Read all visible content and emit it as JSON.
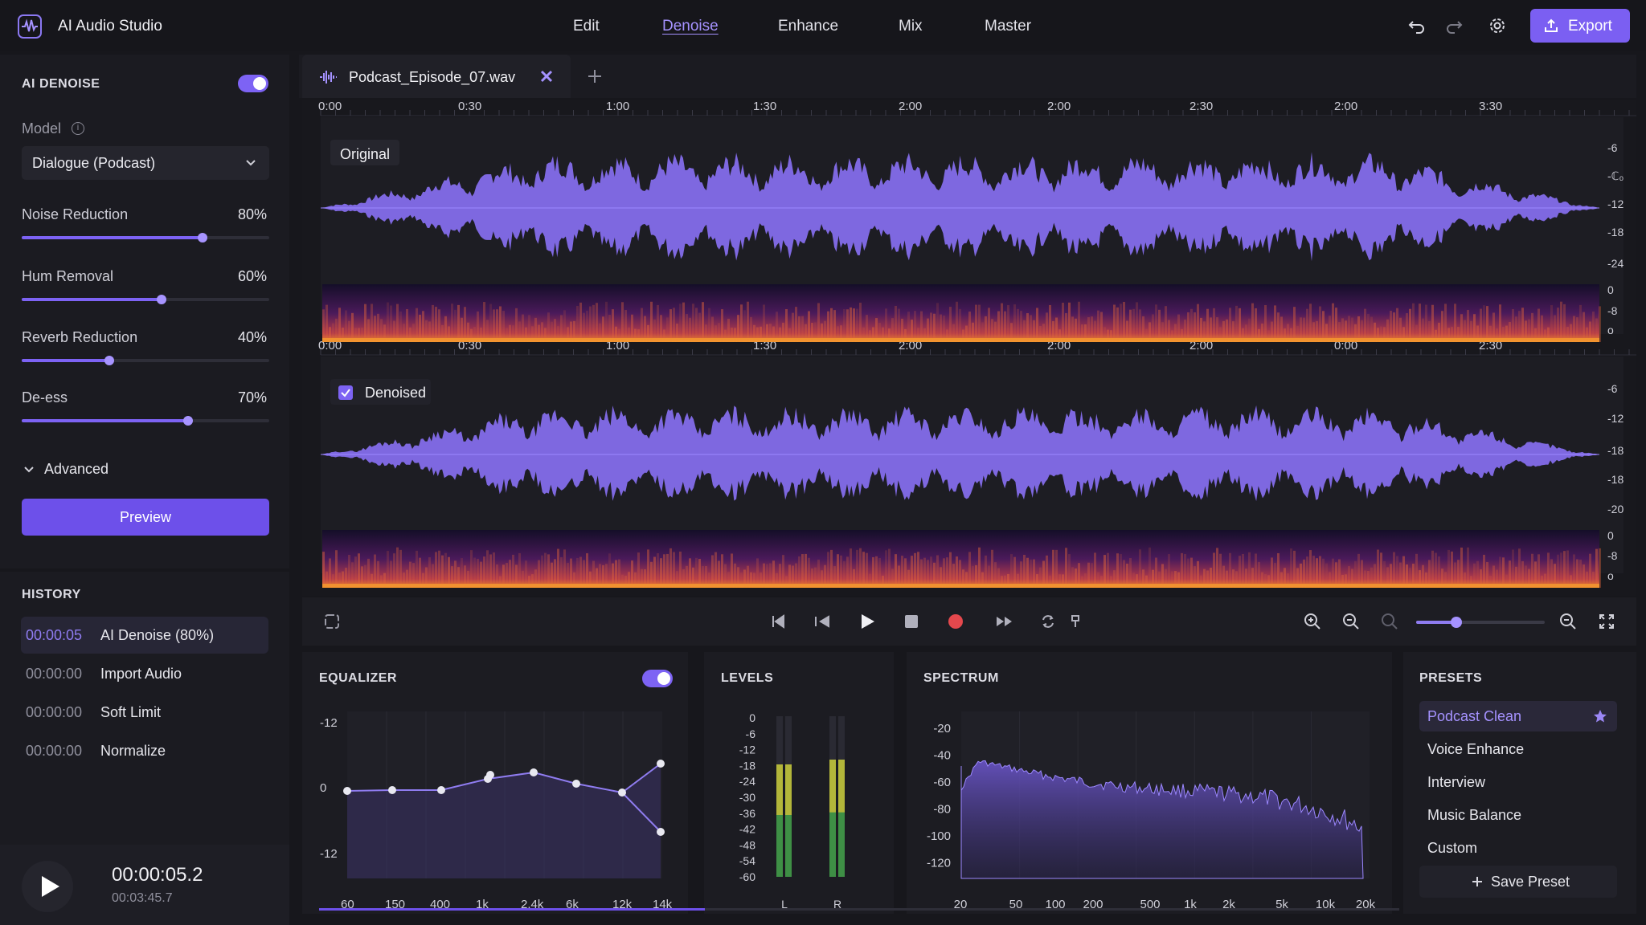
{
  "app": {
    "title": "AI Audio Studio"
  },
  "nav": {
    "tabs": [
      "Edit",
      "Denoise",
      "Enhance",
      "Mix",
      "Master"
    ],
    "active": "Denoise"
  },
  "toolbar": {
    "export_label": "Export"
  },
  "sidebar": {
    "section_title": "AI DENOISE",
    "model_label": "Model",
    "model_value": "Dialogue (Podcast)",
    "sliders": [
      {
        "label": "Noise Reduction",
        "value": 80,
        "display": "80%"
      },
      {
        "label": "Hum Removal",
        "value": 60,
        "display": "60%"
      },
      {
        "label": "Reverb Reduction",
        "value": 40,
        "display": "40%"
      },
      {
        "label": "De-ess",
        "value": 70,
        "display": "70%"
      }
    ],
    "advanced_label": "Advanced",
    "preview_label": "Preview",
    "history_title": "HISTORY",
    "history": [
      {
        "time": "00:00:05",
        "action": "AI Denoise (80%)",
        "active": true
      },
      {
        "time": "00:00:00",
        "action": "Import Audio",
        "active": false
      },
      {
        "time": "00:00:00",
        "action": "Soft Limit",
        "active": false
      },
      {
        "time": "00:00:00",
        "action": "Normalize",
        "active": false
      }
    ]
  },
  "player": {
    "current_time": "00:00:05.2",
    "total_time": "00:03:45.7"
  },
  "file_tab": {
    "name": "Podcast_Episode_07.wav"
  },
  "timeline": {
    "top_ruler": [
      "0:00",
      "0:30",
      "1:00",
      "1:30",
      "2:00",
      "2:00",
      "2:30",
      "2:00",
      "3:30"
    ],
    "bottom_ruler": [
      "0:00",
      "0:30",
      "1:00",
      "1:30",
      "2:00",
      "2:00",
      "2:00",
      "0:00",
      "2:30"
    ]
  },
  "tracks": {
    "original_label": "Original",
    "denoised_label": "Denoised",
    "original_db": [
      "-6",
      "-ℂ₀",
      "-12",
      "-18",
      "-24"
    ],
    "original_spec": [
      "0",
      "-8",
      "o"
    ],
    "denoised_db": [
      "-6",
      "-12",
      "-18",
      "-18",
      "-20"
    ],
    "denoised_spec": [
      "0",
      "-8",
      "o"
    ]
  },
  "equalizer": {
    "title": "EQUALIZER",
    "y_ticks": [
      "-12",
      "0",
      "-12"
    ],
    "x_ticks": [
      "60",
      "150",
      "400",
      "1k",
      "2.4k",
      "6k",
      "12k",
      "14k"
    ]
  },
  "levels": {
    "title": "LEVELS",
    "ticks": [
      "0",
      "-6",
      "-12",
      "-18",
      "-24",
      "-30",
      "-36",
      "-42",
      "-48",
      "-54",
      "-60"
    ],
    "channels": [
      "L",
      "R"
    ],
    "L": 0.7,
    "R": 0.73
  },
  "spectrum": {
    "title": "SPECTRUM",
    "y_ticks": [
      "-20",
      "-40",
      "-60",
      "-80",
      "-100",
      "-120"
    ],
    "x_ticks": [
      "20",
      "50",
      "100",
      "200",
      "500",
      "1k",
      "2k",
      "5k",
      "10k",
      "20k"
    ]
  },
  "presets": {
    "title": "PRESETS",
    "items": [
      "Podcast Clean",
      "Voice Enhance",
      "Interview",
      "Music Balance",
      "Custom"
    ],
    "active": "Podcast Clean",
    "save_label": "Save Preset"
  },
  "colors": {
    "accent": "#7d63f4",
    "accent_light": "#a592ff",
    "record": "#e5484d"
  }
}
